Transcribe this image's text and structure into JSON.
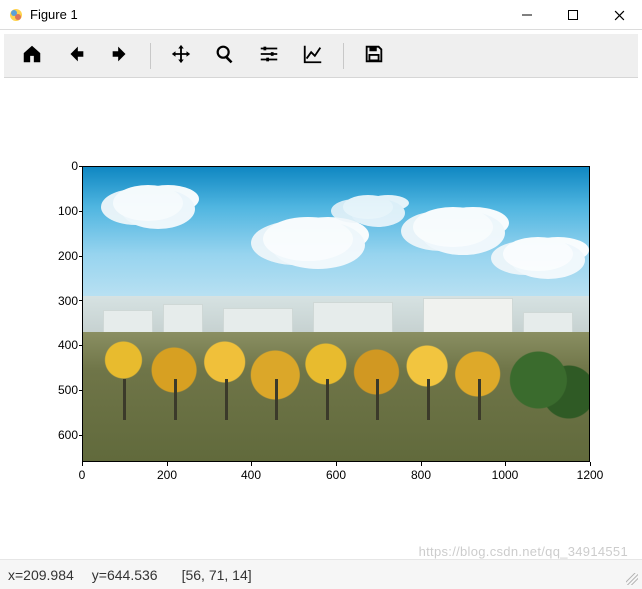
{
  "window": {
    "title": "Figure 1"
  },
  "toolbar": {
    "home": "Home",
    "back": "Back",
    "forward": "Forward",
    "pan": "Pan",
    "zoom": "Zoom",
    "subplots": "Configure subplots",
    "axes_editor": "Edit axis",
    "save": "Save"
  },
  "status": {
    "x_label": "x=209.984",
    "y_label": "y=644.536",
    "pixel": "[56, 71, 14]"
  },
  "watermark": "https://blog.csdn.net/qq_34914551",
  "chart_data": {
    "type": "image",
    "title": "",
    "xlabel": "",
    "ylabel": "",
    "xlim": [
      0,
      1200
    ],
    "ylim": [
      660,
      0
    ],
    "xticks": [
      0,
      200,
      400,
      600,
      800,
      1000,
      1200
    ],
    "yticks": [
      0,
      100,
      200,
      300,
      400,
      500,
      600
    ],
    "image_description": "Landscape photograph: bright blue sky with white cumulus clouds in upper half; distant white/grey low-rise city buildings at the horizon; a row of autumn trees with bright yellow-orange foliage in front; green-brown ground and a dark green tree cluster at lower right.",
    "image_shape": [
      660,
      1200,
      3
    ],
    "cursor_sample": {
      "x": 209.984,
      "y": 644.536,
      "rgb": [
        56,
        71,
        14
      ]
    }
  }
}
